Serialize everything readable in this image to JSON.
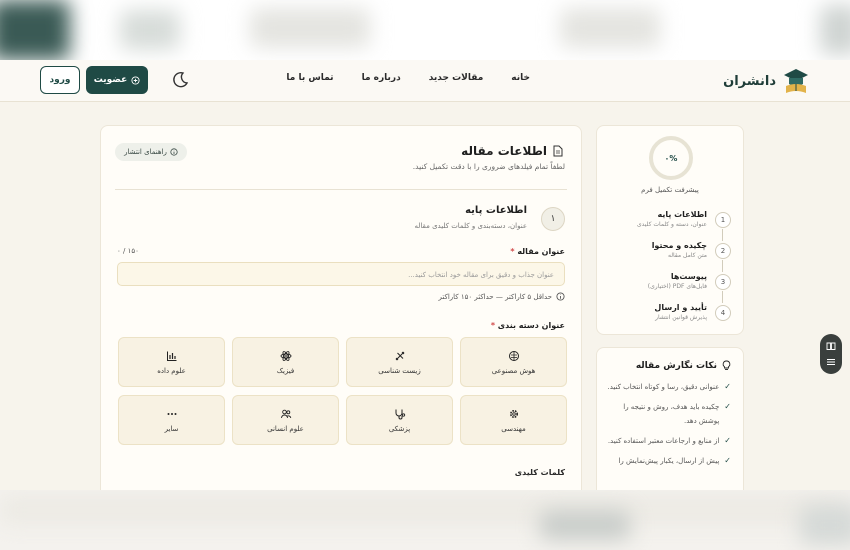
{
  "brand": {
    "name": "دانشران"
  },
  "nav": {
    "links": [
      "خانه",
      "مقالات جدید",
      "درباره ما",
      "تماس با ما"
    ],
    "join": "عضویت",
    "login": "ورود"
  },
  "main": {
    "title": "اطلاعات مقاله",
    "subtitle": "لطفاً تمام فیلدهای ضروری را با دقت تکمیل کنید.",
    "guide": "راهنمای انتشار",
    "step": "۱",
    "section_title": "اطلاعات پایه",
    "section_sub": "عنوان، دسته‌بندی و کلمات کلیدی مقاله",
    "title_label": "عنوان مقاله",
    "title_counter": "۰ / ۱۵۰",
    "title_placeholder": "عنوان جذاب و دقیق برای مقاله خود انتخاب کنید...",
    "title_hint": "حداقل ۵ کاراکتر — حداکثر ۱۵۰ کاراکتر",
    "category_label": "عنوان دسته بندی",
    "keywords_label": "کلمات کلیدی",
    "categories": [
      {
        "label": "هوش مصنوعی",
        "icon": "brain-icon"
      },
      {
        "label": "زیست شناسی",
        "icon": "dna-icon"
      },
      {
        "label": "فیزیک",
        "icon": "atom-icon"
      },
      {
        "label": "علوم داده",
        "icon": "chart-icon"
      },
      {
        "label": "مهندسی",
        "icon": "gear-icon"
      },
      {
        "label": "پزشکی",
        "icon": "stethoscope-icon"
      },
      {
        "label": "علوم انسانی",
        "icon": "users-icon"
      },
      {
        "label": "سایر",
        "icon": "dots-icon"
      }
    ]
  },
  "progress": {
    "value": "۰%",
    "label": "پیشرفت تکمیل فرم",
    "steps": [
      {
        "n": "1",
        "title": "اطلاعات پایه",
        "sub": "عنوان، دسته و کلمات کلیدی"
      },
      {
        "n": "2",
        "title": "چکیده و محتوا",
        "sub": "متن کامل مقاله"
      },
      {
        "n": "3",
        "title": "پیوست‌ها",
        "sub": "فایل‌های PDF (اختیاری)"
      },
      {
        "n": "4",
        "title": "تأیید و ارسال",
        "sub": "پذیرش قوانین انتشار"
      }
    ]
  },
  "tips": {
    "title": "نکات نگارش مقاله",
    "items": [
      "عنوانی دقیق، رسا و کوتاه انتخاب کنید.",
      "چکیده باید هدف، روش و نتیجه را پوشش دهد.",
      "از منابع و ارجاعات معتبر استفاده کنید.",
      "پیش از ارسال، یکبار پیش‌نمایش را"
    ]
  },
  "colors": {
    "primary": "#1f4a45",
    "background": "#f7f4ec",
    "required": "#d24b4b"
  }
}
